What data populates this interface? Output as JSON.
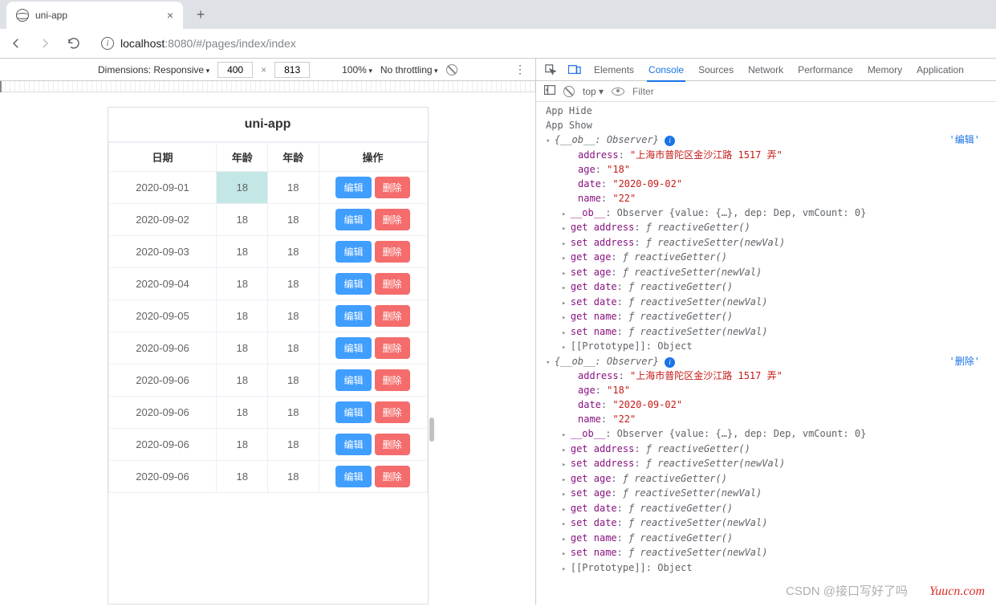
{
  "browser": {
    "tab_title": "uni-app",
    "url_host": "localhost",
    "url_port": ":8080",
    "url_path": "/#/pages/index/index"
  },
  "device_bar": {
    "dimensions_label": "Dimensions: Responsive",
    "width": "400",
    "height": "813",
    "zoom": "100%",
    "throttling": "No throttling"
  },
  "app": {
    "title": "uni-app",
    "headers": [
      "日期",
      "年龄",
      "年龄",
      "操作"
    ],
    "edit_label": "编辑",
    "delete_label": "删除",
    "rows": [
      {
        "date": "2020-09-01",
        "age1": "18",
        "age2": "18"
      },
      {
        "date": "2020-09-02",
        "age1": "18",
        "age2": "18"
      },
      {
        "date": "2020-09-03",
        "age1": "18",
        "age2": "18"
      },
      {
        "date": "2020-09-04",
        "age1": "18",
        "age2": "18"
      },
      {
        "date": "2020-09-05",
        "age1": "18",
        "age2": "18"
      },
      {
        "date": "2020-09-06",
        "age1": "18",
        "age2": "18"
      },
      {
        "date": "2020-09-06",
        "age1": "18",
        "age2": "18"
      },
      {
        "date": "2020-09-06",
        "age1": "18",
        "age2": "18"
      },
      {
        "date": "2020-09-06",
        "age1": "18",
        "age2": "18"
      },
      {
        "date": "2020-09-06",
        "age1": "18",
        "age2": "18"
      }
    ]
  },
  "devtools": {
    "tabs": [
      "Elements",
      "Console",
      "Sources",
      "Network",
      "Performance",
      "Memory",
      "Application"
    ],
    "active_tab": "Console",
    "context": "top",
    "filter_placeholder": "Filter",
    "messages": {
      "app_hide": "App Hide",
      "app_show": "App Show"
    },
    "objects": [
      {
        "tag": "'编辑'",
        "header": "{__ob__: Observer}",
        "props": {
          "address": "\"上海市普陀区金沙江路 1517 弄\"",
          "age": "\"18\"",
          "date": "\"2020-09-02\"",
          "name": "\"22\""
        },
        "ob_line": "Observer {value: {…}, dep: Dep, vmCount: 0}",
        "accessors": [
          "get address: ƒ reactiveGetter()",
          "set address: ƒ reactiveSetter(newVal)",
          "get age: ƒ reactiveGetter()",
          "set age: ƒ reactiveSetter(newVal)",
          "get date: ƒ reactiveGetter()",
          "set date: ƒ reactiveSetter(newVal)",
          "get name: ƒ reactiveGetter()",
          "set name: ƒ reactiveSetter(newVal)"
        ],
        "proto": "[[Prototype]]: Object"
      },
      {
        "tag": "'删除'",
        "header": "{__ob__: Observer}",
        "props": {
          "address": "\"上海市普陀区金沙江路 1517 弄\"",
          "age": "\"18\"",
          "date": "\"2020-09-02\"",
          "name": "\"22\""
        },
        "ob_line": "Observer {value: {…}, dep: Dep, vmCount: 0}",
        "accessors": [
          "get address: ƒ reactiveGetter()",
          "set address: ƒ reactiveSetter(newVal)",
          "get age: ƒ reactiveGetter()",
          "set age: ƒ reactiveSetter(newVal)",
          "get date: ƒ reactiveGetter()",
          "set date: ƒ reactiveSetter(newVal)",
          "get name: ƒ reactiveGetter()",
          "set name: ƒ reactiveSetter(newVal)"
        ],
        "proto": "[[Prototype]]: Object"
      }
    ]
  },
  "watermark": {
    "site": "Yuucn.com",
    "csdn": "CSDN @接口写好了吗"
  }
}
